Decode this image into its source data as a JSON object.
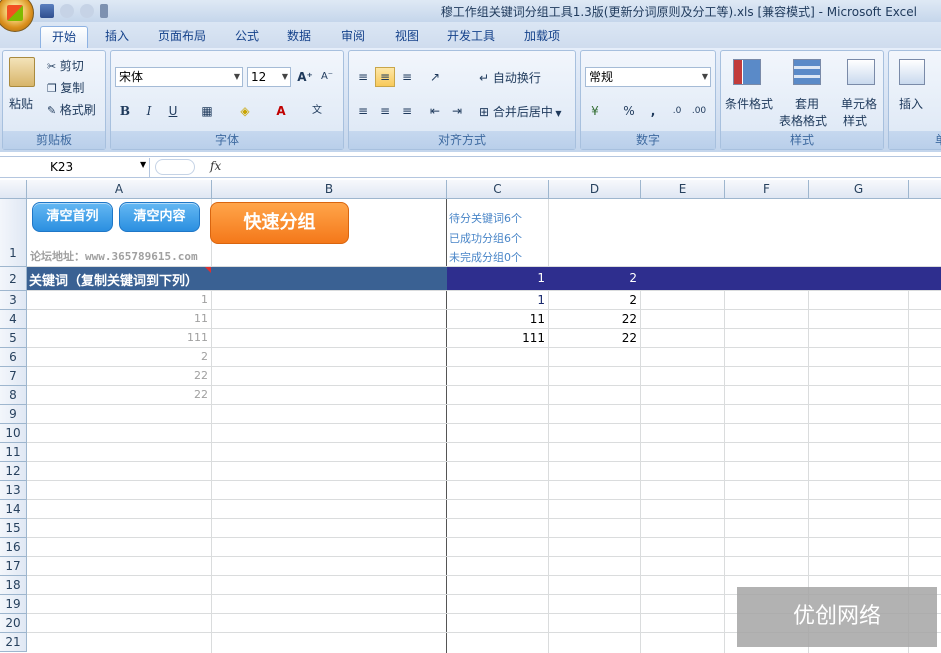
{
  "window": {
    "title": "穆工作组关键词分组工具1.3版(更新分词原则及分工等).xls  [兼容模式] - Microsoft Excel"
  },
  "tabs": [
    "开始",
    "插入",
    "页面布局",
    "公式",
    "数据",
    "审阅",
    "视图",
    "开发工具",
    "加载项"
  ],
  "ribbon": {
    "clipboard": {
      "paste": "粘贴",
      "cut": "剪切",
      "copy": "复制",
      "format_painter": "格式刷",
      "label": "剪贴板"
    },
    "font": {
      "name": "宋体",
      "size": "12",
      "bold": "B",
      "italic": "I",
      "underline": "U",
      "label": "字体"
    },
    "alignment": {
      "wrap": "自动换行",
      "merge": "合并后居中",
      "label": "对齐方式"
    },
    "number": {
      "format": "常规",
      "percent": "%",
      "comma": ",",
      "label": "数字"
    },
    "styles": {
      "conditional": "条件格式",
      "table1": "套用",
      "table2": "表格格式",
      "cell1": "单元格",
      "cell2": "样式",
      "label": "样式"
    },
    "cells": {
      "insert": "插入",
      "label": "单"
    }
  },
  "formula_bar": {
    "name_box": "K23",
    "fx": "fx",
    "value": ""
  },
  "columns": [
    "A",
    "B",
    "C",
    "D",
    "E",
    "F",
    "G"
  ],
  "rows": [
    "1",
    "2",
    "3",
    "4",
    "5",
    "6",
    "7",
    "8",
    "9",
    "10",
    "11",
    "12",
    "13",
    "14",
    "15",
    "16",
    "17",
    "18",
    "19",
    "20",
    "21"
  ],
  "sheet": {
    "buttons": {
      "clear_first": "清空首列",
      "clear_content": "清空内容",
      "quick_group": "快速分组"
    },
    "forum": "论坛地址：www.365789615.com",
    "status": [
      "待分关键词6个",
      "已成功分组6个",
      "未完成分组0个"
    ],
    "header_row": {
      "a": "关键词（复制关键词到下列）",
      "c": "1",
      "d": "2"
    },
    "col_a": [
      "1",
      "11",
      "111",
      "2",
      "22",
      "22"
    ],
    "col_c": [
      "1",
      "11",
      "111"
    ],
    "col_d": [
      "2",
      "22",
      "22"
    ]
  },
  "watermark": "优创网络",
  "colors": {
    "header_a": "#3a6193",
    "header_cd": "#2e2e8e"
  }
}
